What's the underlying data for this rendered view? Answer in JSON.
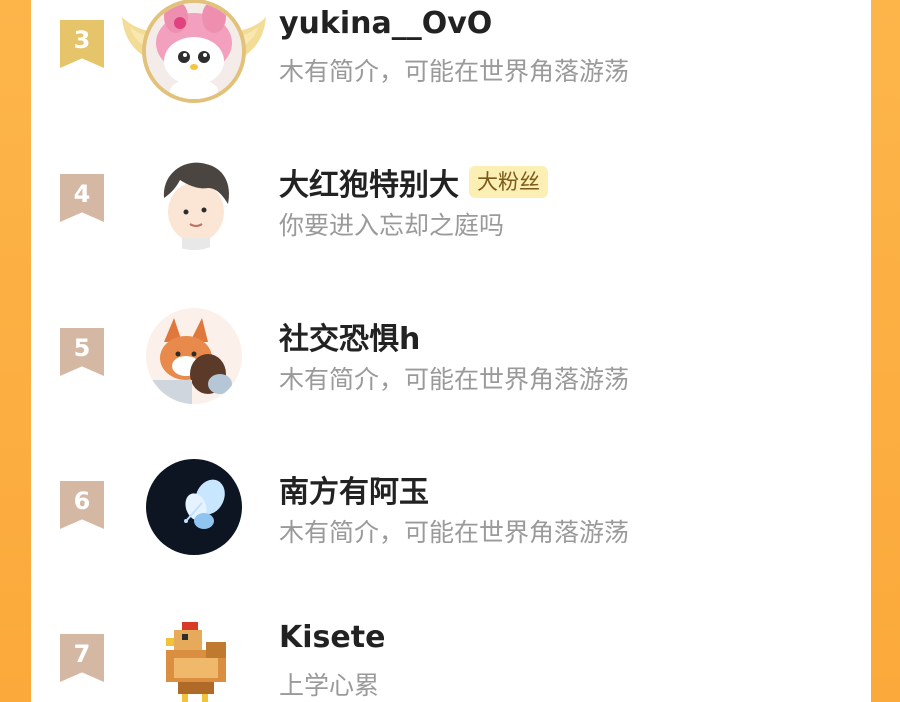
{
  "colors": {
    "background_orange": "#fdb54a",
    "panel": "#ffffff",
    "rank_badge": "#d5b8a3",
    "rank_badge_top3": "#e6c46a",
    "name_text": "#222222",
    "bio_text": "#9a9a9a",
    "fan_badge_bg": "#fbefb3"
  },
  "users": [
    {
      "rank": "3",
      "name": "yukina__OvO",
      "badge": "",
      "bio": "木有简介，可能在世界角落游荡",
      "avatar_icon": "my-melody-plush-avatar-icon"
    },
    {
      "rank": "4",
      "name": "大红狍特别大",
      "badge": "大粉丝",
      "bio": "你要进入忘却之庭吗",
      "avatar_icon": "cartoon-boy-avatar-icon"
    },
    {
      "rank": "5",
      "name": "社交恐惧h",
      "badge": "",
      "bio": "木有简介，可能在世界角落游荡",
      "avatar_icon": "fox-avatar-icon"
    },
    {
      "rank": "6",
      "name": "南方有阿玉",
      "badge": "",
      "bio": "木有简介，可能在世界角落游荡",
      "avatar_icon": "butterfly-avatar-icon"
    },
    {
      "rank": "7",
      "name": "Kisete",
      "badge": "",
      "bio": "上学心累",
      "avatar_icon": "pixel-chicken-avatar-icon"
    }
  ]
}
